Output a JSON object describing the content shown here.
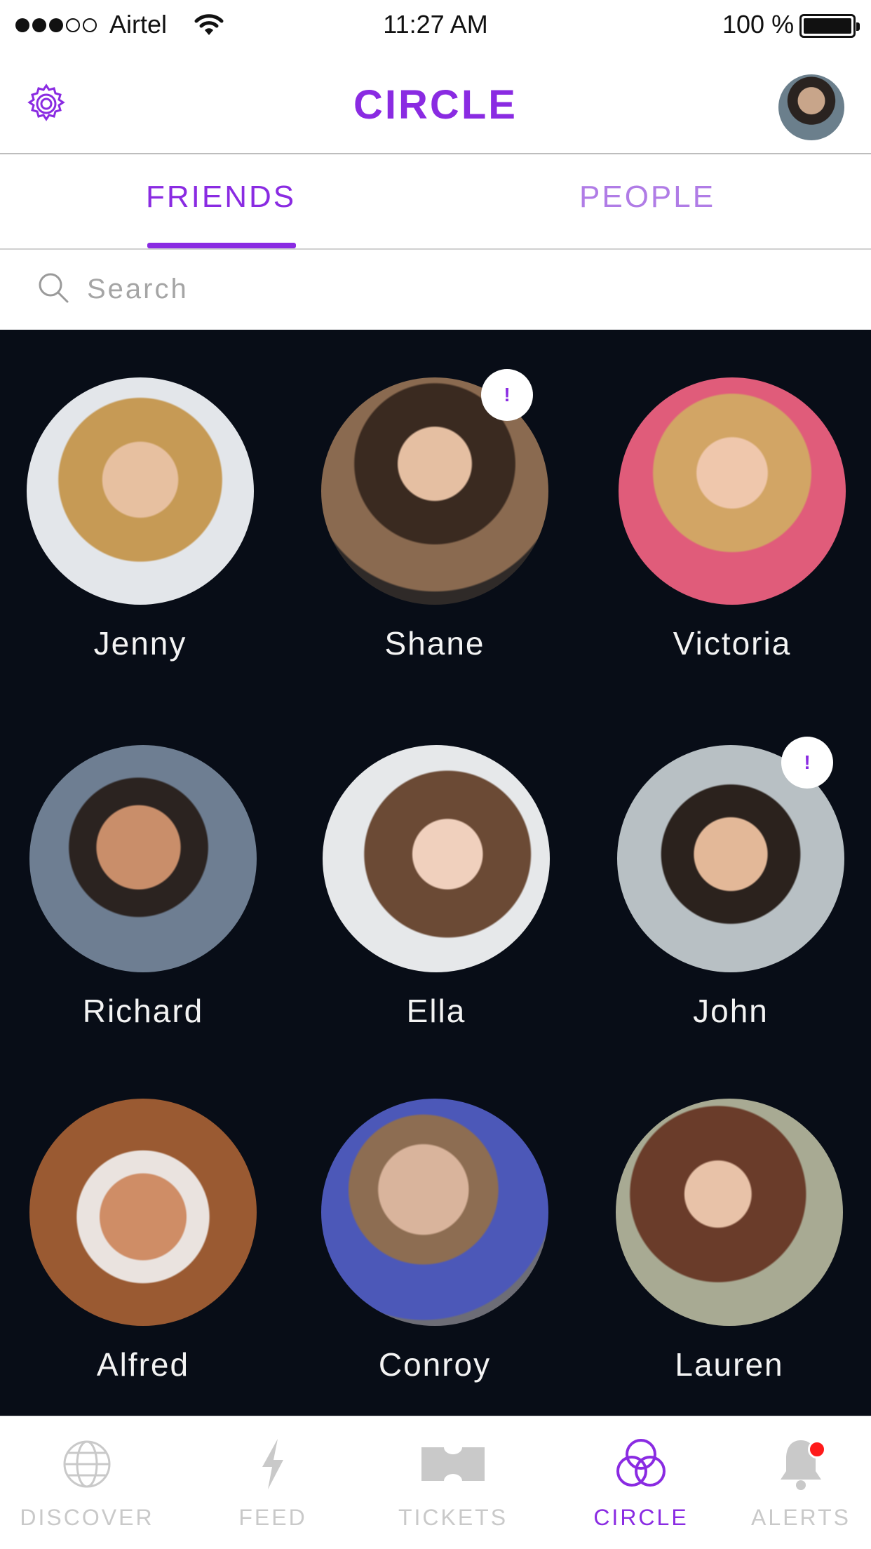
{
  "status_bar": {
    "carrier": "Airtel",
    "time": "11:27 AM",
    "battery": "100 %"
  },
  "header": {
    "title": "CIRCLE"
  },
  "tabs": [
    {
      "label": "FRIENDS",
      "active": true
    },
    {
      "label": "PEOPLE",
      "active": false
    }
  ],
  "search": {
    "placeholder": "Search",
    "value": ""
  },
  "friends": [
    {
      "name": "Jenny",
      "badge": ""
    },
    {
      "name": "Shane",
      "badge": "!"
    },
    {
      "name": "Victoria",
      "badge": ""
    },
    {
      "name": "Richard",
      "badge": ""
    },
    {
      "name": "Ella",
      "badge": ""
    },
    {
      "name": "John",
      "badge": "!"
    },
    {
      "name": "Alfred",
      "badge": ""
    },
    {
      "name": "Conroy",
      "badge": ""
    },
    {
      "name": "Lauren",
      "badge": ""
    }
  ],
  "bottom_nav": [
    {
      "label": "DISCOVER",
      "icon": "globe-icon",
      "active": false
    },
    {
      "label": "FEED",
      "icon": "lightning-icon",
      "active": false
    },
    {
      "label": "TICKETS",
      "icon": "ticket-icon",
      "active": false
    },
    {
      "label": "CIRCLE",
      "icon": "circles-icon",
      "active": true
    },
    {
      "label": "ALERTS",
      "icon": "bell-icon",
      "active": false,
      "notification": true
    }
  ],
  "colors": {
    "accent": "#8a2be2",
    "accent_light": "#b07ce6",
    "grid_background": "#080d17",
    "inactive": "#c9c9c9",
    "notification": "#ff1a1a"
  }
}
